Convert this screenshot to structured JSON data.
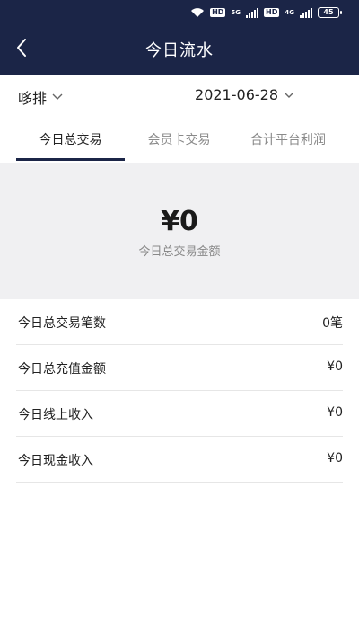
{
  "status_bar": {
    "hd1": "HD",
    "net1": "5G",
    "hd2": "HD",
    "net2": "4G",
    "battery": "45"
  },
  "header": {
    "title": "今日流水"
  },
  "filters": {
    "store": "哆排",
    "date": "2021-06-28"
  },
  "tabs": [
    {
      "label": "今日总交易",
      "active": true
    },
    {
      "label": "会员卡交易",
      "active": false
    },
    {
      "label": "合计平台利润",
      "active": false
    }
  ],
  "summary": {
    "amount": "¥0",
    "label": "今日总交易金额"
  },
  "rows": [
    {
      "label": "今日总交易笔数",
      "value": "0笔"
    },
    {
      "label": "今日总充值金额",
      "value": "¥0"
    },
    {
      "label": "今日线上收入",
      "value": "¥0"
    },
    {
      "label": "今日现金收入",
      "value": "¥0"
    }
  ],
  "colors": {
    "header_bg": "#1b2547",
    "summary_bg": "#f0f0f2",
    "tab_active": "#222222",
    "tab_inactive": "#8a8a8a"
  }
}
